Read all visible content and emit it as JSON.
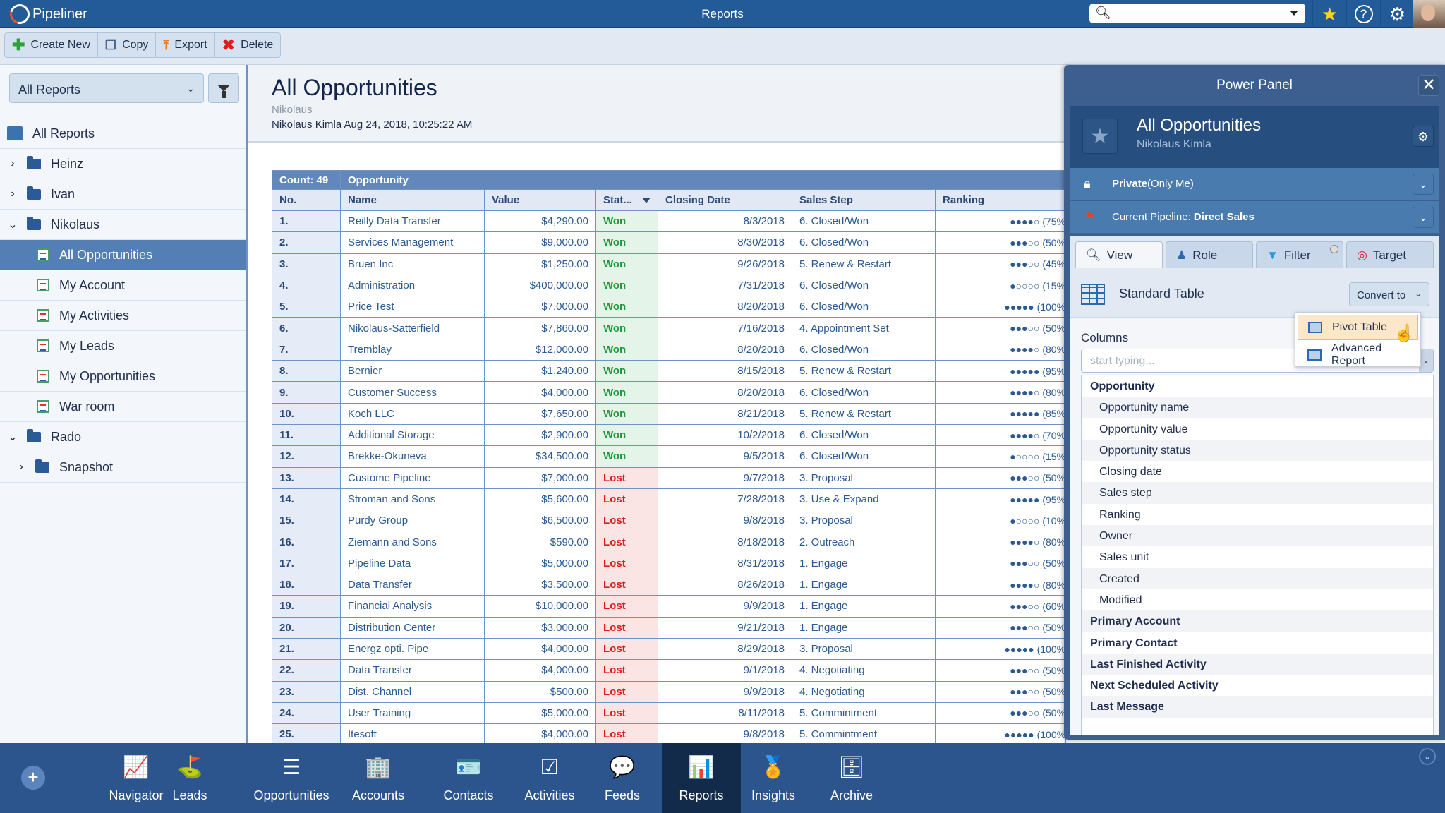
{
  "app": {
    "brand": "Pipeliner",
    "title": "Reports"
  },
  "topbar": {
    "search_placeholder": "",
    "icons": [
      "search-icon",
      "star-icon",
      "help-icon",
      "gear-icon",
      "user-avatar"
    ]
  },
  "toolbar": {
    "create_label": "Create New",
    "copy_label": "Copy",
    "export_label": "Export",
    "delete_label": "Delete"
  },
  "sidebar": {
    "select_value": "All Reports",
    "tree": [
      {
        "label": "All Reports",
        "type": "root",
        "level": 0
      },
      {
        "label": "Heinz",
        "type": "folder",
        "level": 0,
        "expanded": false
      },
      {
        "label": "Ivan",
        "type": "folder",
        "level": 0,
        "expanded": false
      },
      {
        "label": "Nikolaus",
        "type": "folder",
        "level": 0,
        "expanded": true
      },
      {
        "label": "All Opportunities",
        "type": "report",
        "level": 1,
        "selected": true
      },
      {
        "label": "My Account",
        "type": "report",
        "level": 1
      },
      {
        "label": "My Activities",
        "type": "report",
        "level": 1
      },
      {
        "label": "My Leads",
        "type": "report",
        "level": 1
      },
      {
        "label": "My Opportunities",
        "type": "report",
        "level": 1
      },
      {
        "label": "War room",
        "type": "report",
        "level": 1
      },
      {
        "label": "Rado",
        "type": "folder",
        "level": 0,
        "expanded": true
      },
      {
        "label": "Snapshot",
        "type": "folder",
        "level": 1,
        "expanded": false
      }
    ]
  },
  "report": {
    "title": "All Opportunities",
    "folder": "Nikolaus",
    "meta": "Nikolaus Kimla Aug 24, 2018, 10:25:22 AM",
    "count_label": "Count: 49",
    "group_label": "Opportunity",
    "columns": [
      "No.",
      "Name",
      "Value",
      "Stat...",
      "Closing Date",
      "Sales Step",
      "Ranking"
    ],
    "rows": [
      {
        "no": "1.",
        "name": "Reilly Data Transfer",
        "value": "$4,290.00",
        "status": "Won",
        "date": "8/3/2018",
        "step": "6. Closed/Won",
        "dots": 4,
        "pct": "(75%"
      },
      {
        "no": "2.",
        "name": "Services Management",
        "value": "$9,000.00",
        "status": "Won",
        "date": "8/30/2018",
        "step": "6. Closed/Won",
        "dots": 3,
        "pct": "(50%"
      },
      {
        "no": "3.",
        "name": "Bruen Inc",
        "value": "$1,250.00",
        "status": "Won",
        "date": "9/26/2018",
        "step": "5. Renew & Restart",
        "dots": 3,
        "pct": "(45%"
      },
      {
        "no": "4.",
        "name": "Administration",
        "value": "$400,000.00",
        "status": "Won",
        "date": "7/31/2018",
        "step": "6. Closed/Won",
        "dots": 1,
        "pct": "(15%"
      },
      {
        "no": "5.",
        "name": "Price Test",
        "value": "$7,000.00",
        "status": "Won",
        "date": "8/20/2018",
        "step": "6. Closed/Won",
        "dots": 5,
        "pct": "(100%"
      },
      {
        "no": "6.",
        "name": "Nikolaus-Satterfield",
        "value": "$7,860.00",
        "status": "Won",
        "date": "7/16/2018",
        "step": "4. Appointment Set",
        "dots": 3,
        "pct": "(50%"
      },
      {
        "no": "7.",
        "name": "Tremblay",
        "value": "$12,000.00",
        "status": "Won",
        "date": "8/20/2018",
        "step": "6. Closed/Won",
        "dots": 4,
        "pct": "(80%"
      },
      {
        "no": "8.",
        "name": "Bernier",
        "value": "$1,240.00",
        "status": "Won",
        "date": "8/15/2018",
        "step": "5. Renew & Restart",
        "dots": 5,
        "pct": "(95%"
      },
      {
        "no": "9.",
        "name": "Customer Success",
        "value": "$4,000.00",
        "status": "Won",
        "date": "8/20/2018",
        "step": "6. Closed/Won",
        "dots": 4,
        "pct": "(80%"
      },
      {
        "no": "10.",
        "name": "Koch LLC",
        "value": "$7,650.00",
        "status": "Won",
        "date": "8/21/2018",
        "step": "5. Renew & Restart",
        "dots": 5,
        "pct": "(85%"
      },
      {
        "no": "11.",
        "name": "Additional Storage",
        "value": "$2,900.00",
        "status": "Won",
        "date": "10/2/2018",
        "step": "6. Closed/Won",
        "dots": 4,
        "pct": "(70%"
      },
      {
        "no": "12.",
        "name": "Brekke-Okuneva",
        "value": "$34,500.00",
        "status": "Won",
        "date": "9/5/2018",
        "step": "6. Closed/Won",
        "dots": 1,
        "pct": "(15%"
      },
      {
        "no": "13.",
        "name": "Custome Pipeline",
        "value": "$7,000.00",
        "status": "Lost",
        "date": "9/7/2018",
        "step": "3. Proposal",
        "dots": 3,
        "pct": "(50%"
      },
      {
        "no": "14.",
        "name": "Stroman and Sons",
        "value": "$5,600.00",
        "status": "Lost",
        "date": "7/28/2018",
        "step": "3. Use & Expand",
        "dots": 5,
        "pct": "(95%"
      },
      {
        "no": "15.",
        "name": "Purdy Group",
        "value": "$6,500.00",
        "status": "Lost",
        "date": "9/8/2018",
        "step": "3. Proposal",
        "dots": 1,
        "pct": "(10%"
      },
      {
        "no": "16.",
        "name": "Ziemann and Sons",
        "value": "$590.00",
        "status": "Lost",
        "date": "8/18/2018",
        "step": "2. Outreach",
        "dots": 4,
        "pct": "(80%"
      },
      {
        "no": "17.",
        "name": "Pipeline Data",
        "value": "$5,000.00",
        "status": "Lost",
        "date": "8/31/2018",
        "step": "1. Engage",
        "dots": 3,
        "pct": "(50%"
      },
      {
        "no": "18.",
        "name": "Data Transfer",
        "value": "$3,500.00",
        "status": "Lost",
        "date": "8/26/2018",
        "step": "1. Engage",
        "dots": 4,
        "pct": "(80%"
      },
      {
        "no": "19.",
        "name": "Financial Analysis",
        "value": "$10,000.00",
        "status": "Lost",
        "date": "9/9/2018",
        "step": "1. Engage",
        "dots": 3,
        "pct": "(60%"
      },
      {
        "no": "20.",
        "name": "Distribution Center",
        "value": "$3,000.00",
        "status": "Lost",
        "date": "9/21/2018",
        "step": "1. Engage",
        "dots": 3,
        "pct": "(50%"
      },
      {
        "no": "21.",
        "name": "Energz opti. Pipe",
        "value": "$4,000.00",
        "status": "Lost",
        "date": "8/29/2018",
        "step": "3. Proposal",
        "dots": 5,
        "pct": "(100%"
      },
      {
        "no": "22.",
        "name": "Data Transfer",
        "value": "$4,000.00",
        "status": "Lost",
        "date": "9/1/2018",
        "step": "4. Negotiating",
        "dots": 3,
        "pct": "(50%"
      },
      {
        "no": "23.",
        "name": "Dist. Channel",
        "value": "$500.00",
        "status": "Lost",
        "date": "9/9/2018",
        "step": "4. Negotiating",
        "dots": 3,
        "pct": "(50%"
      },
      {
        "no": "24.",
        "name": "User Training",
        "value": "$5,000.00",
        "status": "Lost",
        "date": "8/11/2018",
        "step": "5. Commintment",
        "dots": 3,
        "pct": "(50%"
      },
      {
        "no": "25.",
        "name": "Itesoft",
        "value": "$4,000.00",
        "status": "Lost",
        "date": "9/8/2018",
        "step": "5. Commintment",
        "dots": 5,
        "pct": "(100%"
      }
    ]
  },
  "power_panel": {
    "title": "Power Panel",
    "report_name": "All Opportunities",
    "owner": "Nikolaus Kimla",
    "privacy_bold": "Private",
    "privacy_rest": " (Only Me)",
    "pipeline_prefix": "Current Pipeline: ",
    "pipeline_name": "Direct Sales",
    "tabs": [
      "View",
      "Role",
      "Filter",
      "Target"
    ],
    "table_type": "Standard Table",
    "convert_label": "Convert to",
    "convert_options": [
      "Pivot Table",
      "Advanced Report"
    ],
    "columns_label": "Columns",
    "columns_placeholder": "start typing...",
    "column_items": [
      {
        "label": "Opportunity",
        "group": true
      },
      {
        "label": "Opportunity name",
        "group": false
      },
      {
        "label": "Opportunity value",
        "group": false
      },
      {
        "label": "Opportunity status",
        "group": false
      },
      {
        "label": "Closing date",
        "group": false
      },
      {
        "label": "Sales step",
        "group": false
      },
      {
        "label": "Ranking",
        "group": false
      },
      {
        "label": "Owner",
        "group": false
      },
      {
        "label": "Sales unit",
        "group": false
      },
      {
        "label": "Created",
        "group": false
      },
      {
        "label": "Modified",
        "group": false
      },
      {
        "label": "Primary Account",
        "group": true
      },
      {
        "label": "Primary Contact",
        "group": true
      },
      {
        "label": "Last Finished Activity",
        "group": true
      },
      {
        "label": "Next Scheduled Activity",
        "group": true
      },
      {
        "label": "Last Message",
        "group": true
      }
    ]
  },
  "bottom_nav": {
    "items": [
      {
        "label": "Navigator",
        "icon": "navigator-icon",
        "glyph": "📈"
      },
      {
        "label": "Leads",
        "icon": "leads-icon",
        "glyph": "⛳"
      },
      {
        "label": "Opportunities",
        "icon": "opportunities-icon",
        "glyph": "☰"
      },
      {
        "label": "Accounts",
        "icon": "accounts-icon",
        "glyph": "🏢"
      },
      {
        "label": "Contacts",
        "icon": "contacts-icon",
        "glyph": "🪪"
      },
      {
        "label": "Activities",
        "icon": "activities-icon",
        "glyph": "☑"
      },
      {
        "label": "Feeds",
        "icon": "feeds-icon",
        "glyph": "💬"
      },
      {
        "label": "Reports",
        "icon": "reports-icon",
        "glyph": "📊",
        "active": true
      },
      {
        "label": "Insights",
        "icon": "insights-icon",
        "glyph": "🏅"
      },
      {
        "label": "Archive",
        "icon": "archive-icon",
        "glyph": "🗄"
      }
    ]
  },
  "colors": {
    "brand": "#235b98",
    "won": "#1d9a3a",
    "lost": "#e01d1d",
    "selected": "#547fb5"
  }
}
